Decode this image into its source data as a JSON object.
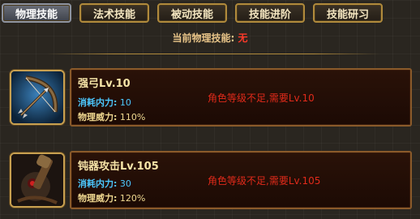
{
  "tabs": [
    {
      "label": "物理技能",
      "active": true
    },
    {
      "label": "法术技能",
      "active": false
    },
    {
      "label": "被动技能",
      "active": false
    },
    {
      "label": "技能进阶",
      "active": false
    },
    {
      "label": "技能研习",
      "active": false
    }
  ],
  "current_skill": {
    "label": "当前物理技能:",
    "value": "无"
  },
  "skills": [
    {
      "icon": "bow-arrow-icon",
      "name": "强弓Lv.10",
      "cost_label": "消耗内力:",
      "cost_value": "10",
      "power_label": "物理威力:",
      "power_value": "110%",
      "requirement": "角色等级不足,需要Lv.10"
    },
    {
      "icon": "blunt-weapon-icon",
      "name": "钝器攻击Lv.105",
      "cost_label": "消耗内力:",
      "cost_value": "30",
      "power_label": "物理威力:",
      "power_value": "120%",
      "requirement": "角色等级不足,需要Lv.105"
    }
  ],
  "colors": {
    "accent_gold": "#b08a3c",
    "requirement_red": "#e02a1a",
    "cost_blue": "#4cc8ff"
  }
}
